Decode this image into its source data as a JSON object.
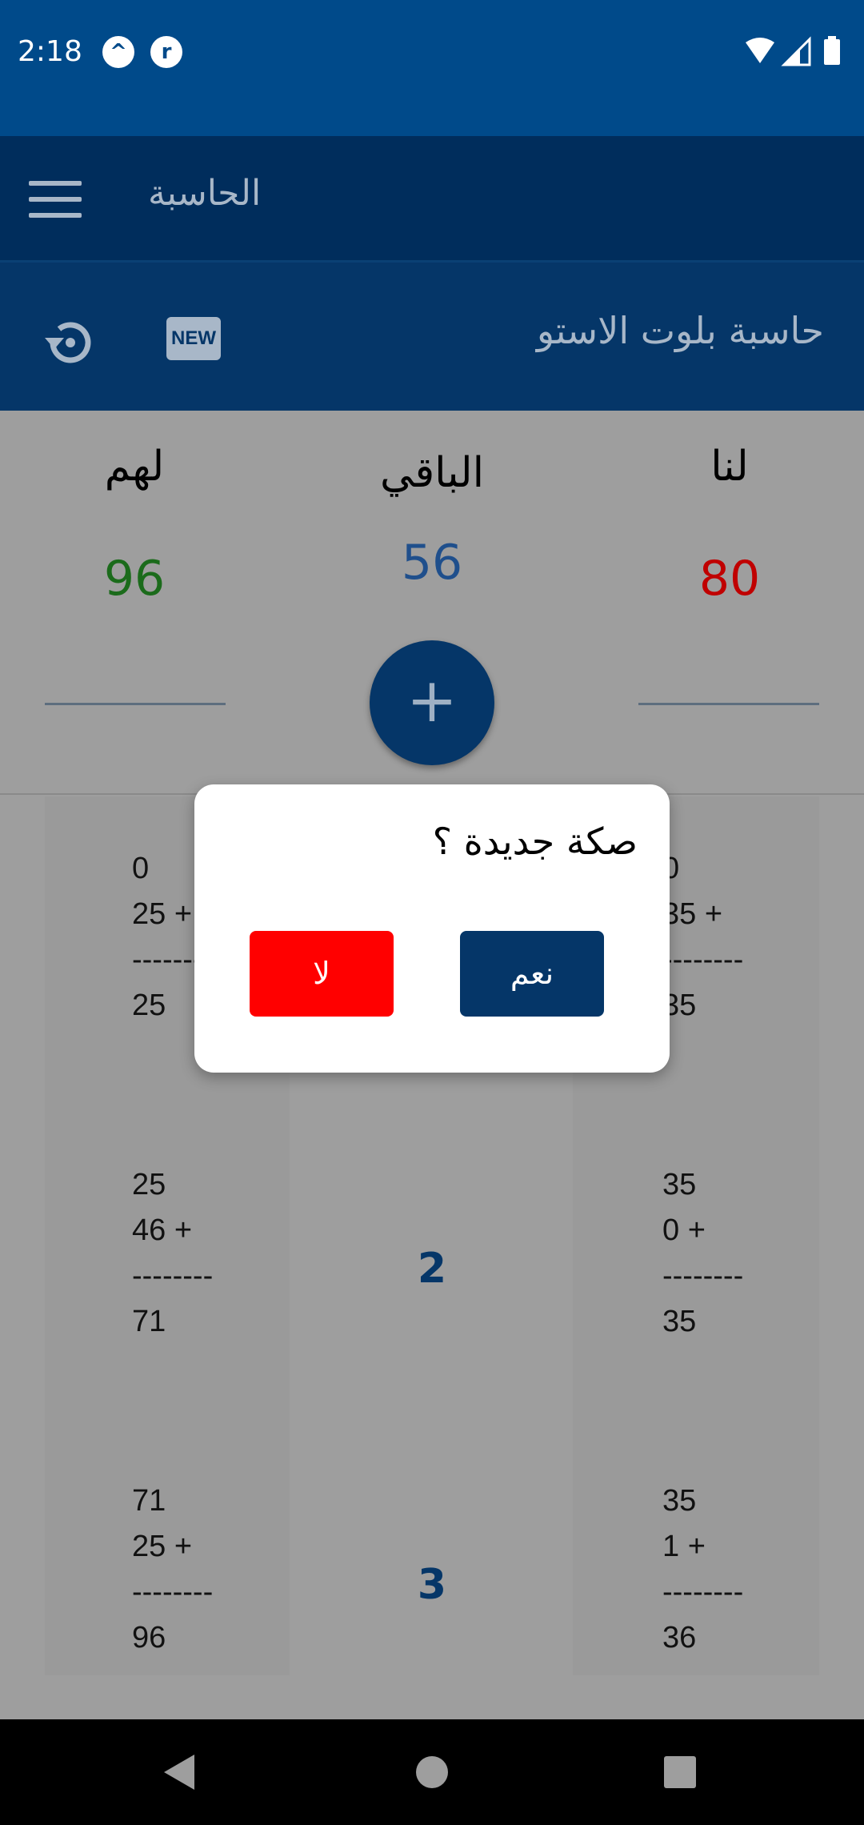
{
  "status": {
    "time": "2:18",
    "icon1": "notification-a-icon",
    "icon2": "notification-b-icon"
  },
  "app_bar": {
    "title": "الحاسبة"
  },
  "sub_bar": {
    "title": "حاسبة بلوت الاستو",
    "new_label": "NEW"
  },
  "scores": {
    "them_label": "لهم",
    "them_value": "96",
    "remaining_label": "الباقي",
    "remaining_value": "56",
    "us_label": "لنا",
    "us_value": "80",
    "them_color": "#1b6b1b",
    "remaining_color": "#1f4f8c",
    "us_color": "#c00000"
  },
  "fab_label": "+",
  "rounds": [
    {
      "num": "",
      "them": [
        "0",
        "25 +",
        "--------",
        "25"
      ],
      "us": [
        "0",
        "35 +",
        "--------",
        "35"
      ]
    },
    {
      "num": "2",
      "them": [
        "25",
        "46 +",
        "--------",
        "71"
      ],
      "us": [
        "35",
        "0 +",
        "--------",
        "35"
      ]
    },
    {
      "num": "3",
      "them": [
        "71",
        "25 +",
        "--------",
        "96"
      ],
      "us": [
        "35",
        "1 +",
        "--------",
        "36"
      ]
    }
  ],
  "dialog": {
    "title": "صكة جديدة ؟",
    "no_label": "لا",
    "yes_label": "نعم"
  }
}
